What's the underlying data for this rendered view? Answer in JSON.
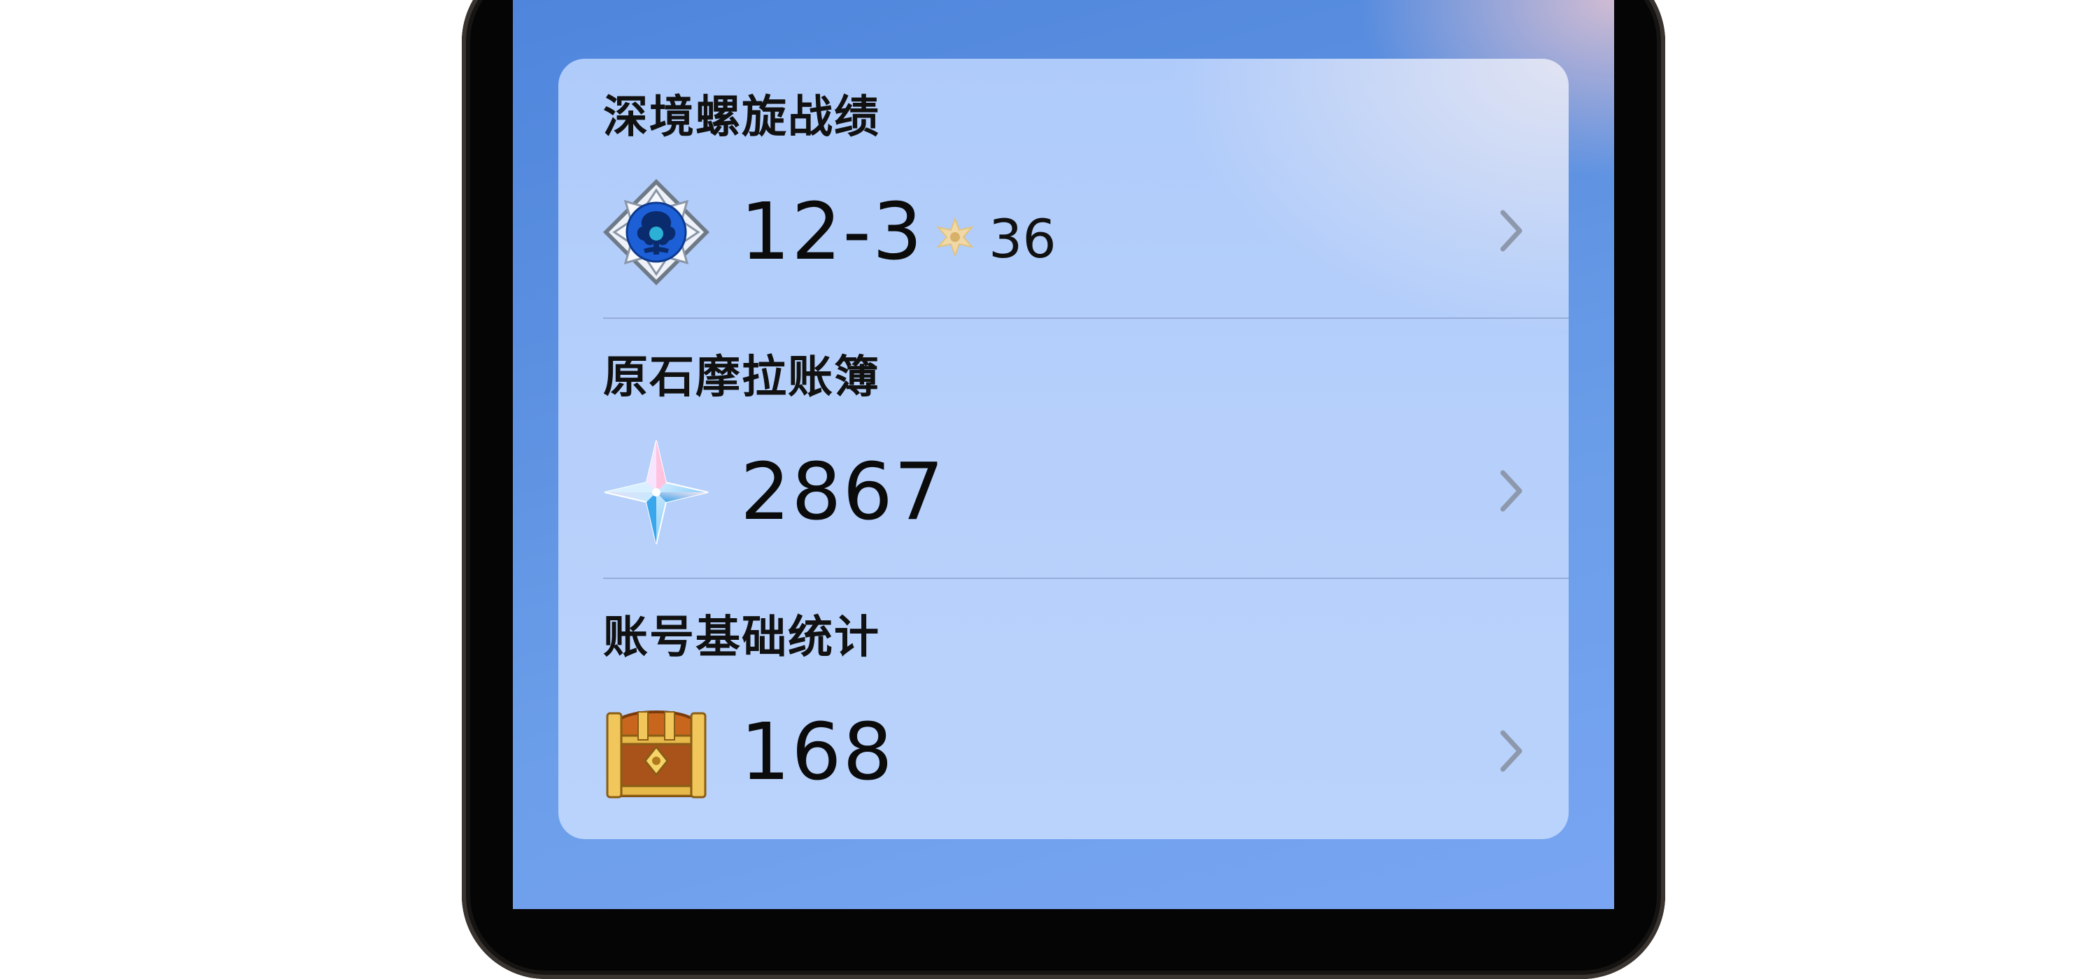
{
  "widget": {
    "sections": [
      {
        "title": "深境螺旋战绩",
        "value": "12-3",
        "star_count": "36",
        "icon": "abyss-emblem-icon",
        "secondary_icon": "abyss-star-icon",
        "chevron_icon": "chevron-right-icon"
      },
      {
        "title": "原石摩拉账簿",
        "value": "2867",
        "icon": "primogem-icon",
        "chevron_icon": "chevron-right-icon"
      },
      {
        "title": "账号基础统计",
        "value": "168",
        "icon": "treasure-chest-icon",
        "chevron_icon": "chevron-right-icon"
      }
    ]
  },
  "colors": {
    "screen_background": "#5b8fe0",
    "card_background": "#b6d0fb",
    "text": "#111111",
    "chevron": "#8d98ac"
  }
}
